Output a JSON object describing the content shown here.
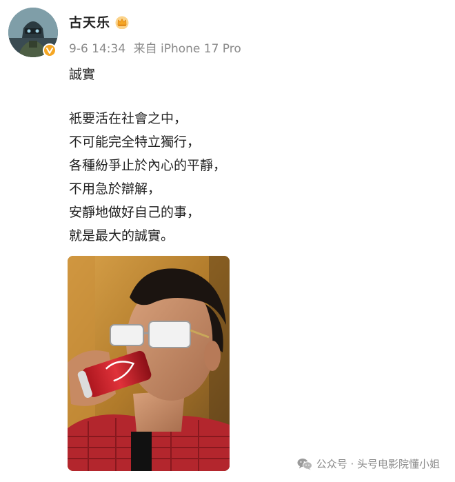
{
  "post": {
    "author": "古天乐",
    "date": "9-6 14:34",
    "source": "来自 iPhone 17 Pro",
    "title": "誠實",
    "lines": [
      "衹要活在社會之中，",
      "不可能完全特立獨行，",
      "各種紛爭止於內心的平靜，",
      "不用急於辯解，",
      "安靜地做好自己的事，",
      "就是最大的誠實。"
    ]
  },
  "watermark": {
    "text": "公众号 · 头号电影院懂小姐"
  },
  "colors": {
    "text": "#222222",
    "meta": "#8a8a8a",
    "badge": "#f5a623",
    "crown": "#f5a623"
  },
  "icons": {
    "avatar": "avatar-image",
    "badge": "verified-badge-icon",
    "crown": "crown-icon",
    "watermark": "wechat-icon"
  }
}
